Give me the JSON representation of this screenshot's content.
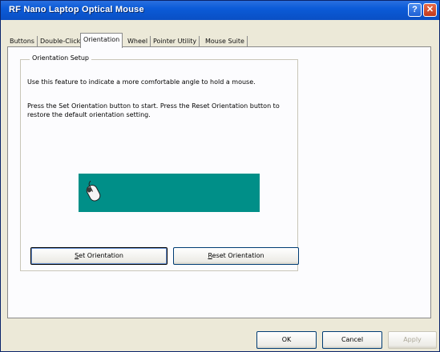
{
  "window": {
    "title": "RF Nano Laptop Optical Mouse",
    "help_glyph": "?",
    "close_glyph": "✕"
  },
  "tabs": [
    {
      "label": "Buttons"
    },
    {
      "label": "Double-Click"
    },
    {
      "label": "Orientation"
    },
    {
      "label": "Wheel"
    },
    {
      "label": "Pointer Utility"
    },
    {
      "label": "Mouse Suite"
    }
  ],
  "active_tab": "Orientation",
  "orientation": {
    "group_title": "Orientation Setup",
    "description": "Use this feature to indicate a more comfortable angle to hold a mouse.",
    "instructions": "Press the Set Orientation button to start. Press the Reset Orientation button to restore the default orientation setting.",
    "set_button": {
      "mnemonic": "S",
      "rest": "et Orientation"
    },
    "reset_button": {
      "mnemonic": "R",
      "rest": "eset Orientation"
    }
  },
  "footer": {
    "ok_label": "OK",
    "cancel_label": "Cancel",
    "apply_label": "Apply"
  },
  "colors": {
    "preview_bg": "#008f88",
    "titlebar": "#0b5bd8"
  },
  "icons": {
    "preview": "mouse-icon"
  }
}
